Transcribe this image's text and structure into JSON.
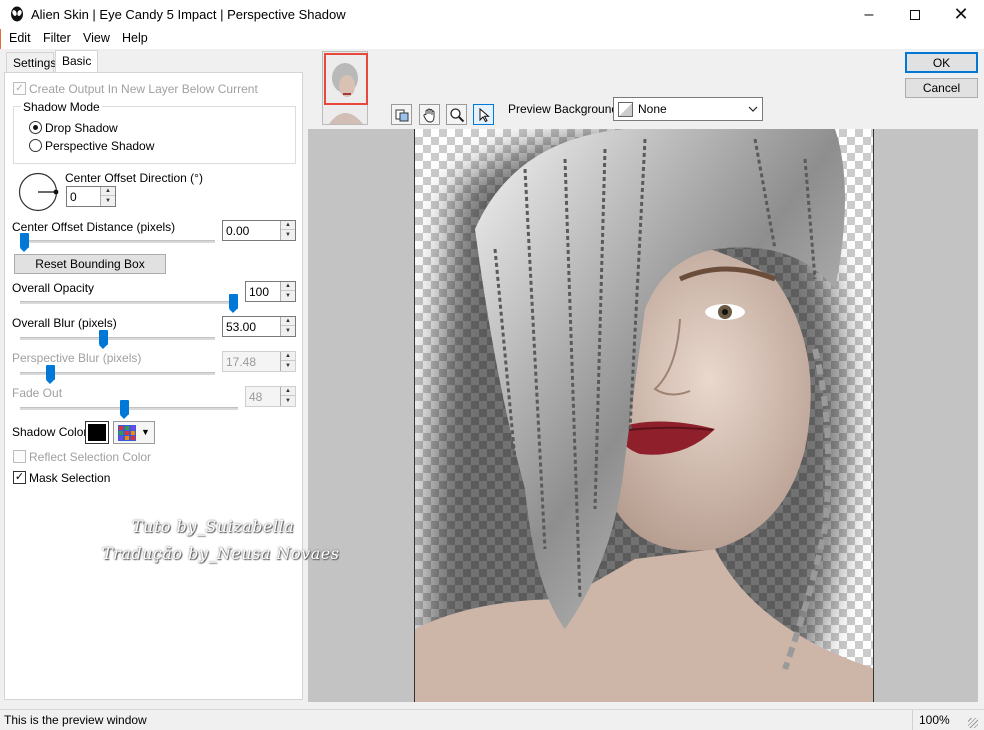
{
  "window": {
    "title": "Alien Skin | Eye Candy 5 Impact | Perspective Shadow",
    "minimize_icon": "minimize-icon",
    "maximize_icon": "maximize-icon",
    "close_icon": "close-icon"
  },
  "menu": [
    "Edit",
    "Filter",
    "View",
    "Help"
  ],
  "tabs": {
    "settings": "Settings",
    "basic": "Basic"
  },
  "basic": {
    "create_output": {
      "label": "Create Output In New Layer Below Current",
      "checked": true,
      "enabled": false
    },
    "shadow_mode": {
      "title": "Shadow Mode",
      "options": [
        "Drop Shadow",
        "Perspective Shadow"
      ],
      "selected": "Drop Shadow"
    },
    "center_offset_direction": {
      "label": "Center Offset Direction (°)",
      "value": "0"
    },
    "center_offset_distance": {
      "label": "Center Offset Distance (pixels)",
      "value": "0.00",
      "fraction": 0.0
    },
    "reset_bounding_box": "Reset Bounding Box",
    "overall_opacity": {
      "label": "Overall Opacity",
      "value": "100",
      "fraction": 1.0
    },
    "overall_blur": {
      "label": "Overall Blur (pixels)",
      "value": "53.00",
      "fraction": 0.4
    },
    "perspective_blur": {
      "label": "Perspective Blur (pixels)",
      "value": "17.48",
      "fraction": 0.13,
      "enabled": false
    },
    "fade_out": {
      "label": "Fade Out",
      "value": "48",
      "fraction": 0.48,
      "enabled": false
    },
    "shadow_color": {
      "label": "Shadow Color",
      "color": "#000000"
    },
    "reflect_selection_color": {
      "label": "Reflect Selection Color",
      "checked": false,
      "enabled": false
    },
    "mask_selection": {
      "label": "Mask Selection",
      "checked": true
    }
  },
  "watermark": {
    "line1": "Tuto by_Suizabella",
    "line2": "Tradução by_Neusa Novaes"
  },
  "buttons": {
    "ok": "OK",
    "cancel": "Cancel"
  },
  "toolbar": {
    "tools": [
      "hand-preview-icon",
      "pan-hand-icon",
      "zoom-icon",
      "select-arrow-icon"
    ],
    "active_tool": "select-arrow-icon",
    "preview_background_label": "Preview Background:",
    "preview_background_value": "None"
  },
  "status": {
    "message": "This is the preview window",
    "zoom": "100%"
  },
  "colors": {
    "accent": "#0078d7",
    "thumb_border": "#e8473b",
    "preview_bg": "#c3c3c3"
  }
}
